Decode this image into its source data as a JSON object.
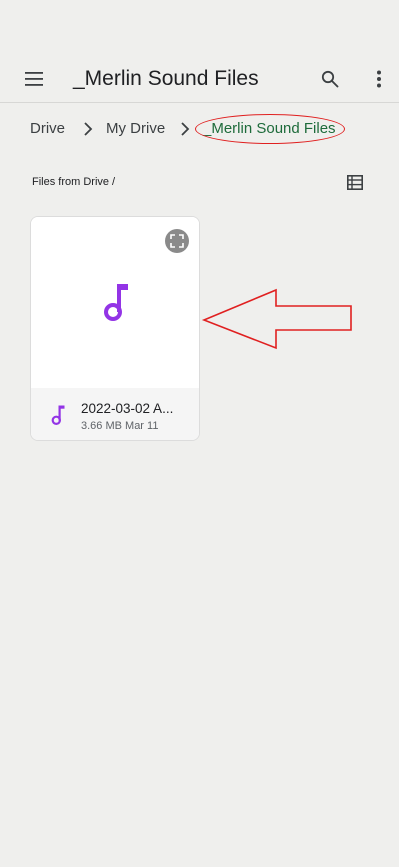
{
  "header": {
    "title": "_Merlin Sound Files",
    "menu_icon": "hamburger-menu-icon",
    "search_icon": "search-icon",
    "more_icon": "more-vertical-icon"
  },
  "breadcrumb": {
    "items": [
      "Drive",
      "My Drive",
      "_Merlin Sound Files"
    ],
    "separator_icon": "chevron-right-icon"
  },
  "section": {
    "label": "Files from Drive /",
    "view_toggle_icon": "list-view-icon"
  },
  "files": [
    {
      "name": "2022-03-02 A...",
      "size": "3.66 MB",
      "date": "Mar 11",
      "type_icon": "music-note-icon",
      "expand_icon": "expand-icon"
    }
  ],
  "colors": {
    "background": "#efefed",
    "accent_music": "#9334e6",
    "current_crumb": "#1e6b3b",
    "annotation": "#e02020"
  }
}
